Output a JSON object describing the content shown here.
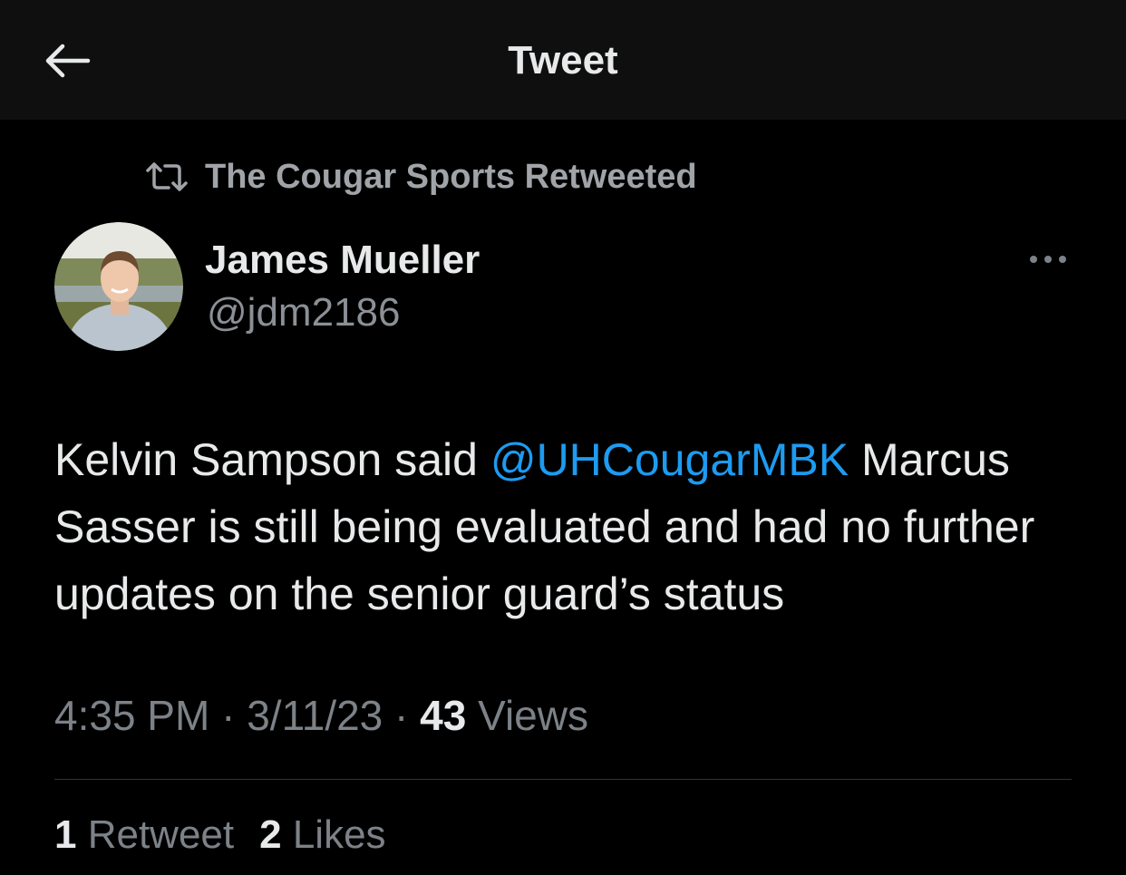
{
  "header": {
    "title": "Tweet",
    "back_icon": "arrow-left-icon"
  },
  "social_context": {
    "icon": "retweet-icon",
    "text": "The Cougar Sports Retweeted"
  },
  "author": {
    "display_name": "James Mueller",
    "handle": "@jdm2186",
    "more_icon": "ellipsis-icon"
  },
  "tweet": {
    "text_before": "Kelvin Sampson said ",
    "mention": "@UHCougarMBK",
    "text_after": " Marcus Sasser is still being evaluated and had no further updates on the senior guard’s status"
  },
  "meta": {
    "time": "4:35 PM",
    "sep1": " · ",
    "date": "3/11/23",
    "sep2": " · ",
    "views_count": "43",
    "views_label": " Views"
  },
  "stats": {
    "retweets_count": "1",
    "retweets_label": " Retweet",
    "likes_count": "2",
    "likes_label": " Likes"
  },
  "colors": {
    "background": "#000000",
    "header": "#0f0f0f",
    "primary_text": "#e7e9ea",
    "secondary_text": "#7c8288",
    "link": "#1d9bf0",
    "divider": "#2f3336"
  }
}
